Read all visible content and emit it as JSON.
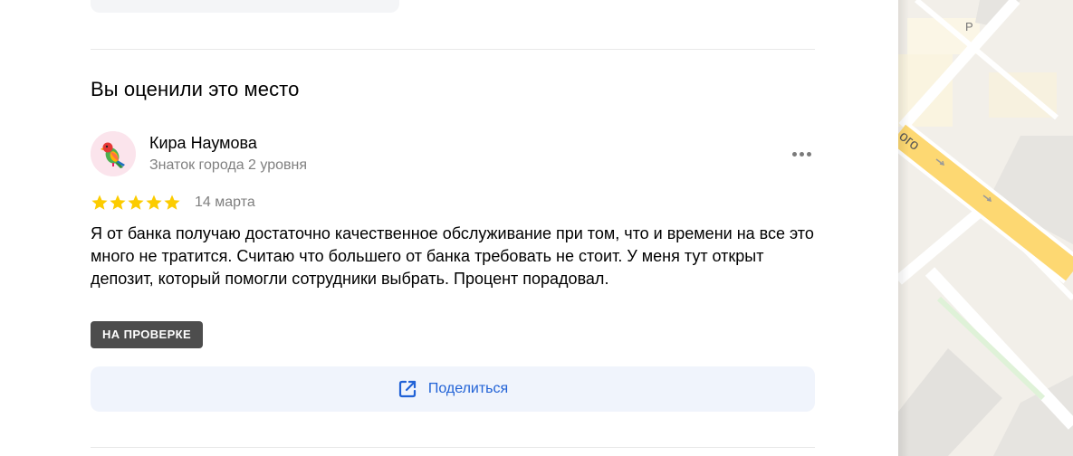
{
  "section": {
    "title": "Вы оценили это место"
  },
  "review": {
    "author_name": "Кира Наумова",
    "author_level": "Знаток города 2 уровня",
    "rating": 5,
    "rating_max": 5,
    "date": "14 марта",
    "text": "Я от банка получаю достаточно качественное обслуживание при том, что и времени на все это много не тратится. Считаю что большего от банка требовать не стоит. У меня тут открыт депозит, который помогли сотрудники выбрать. Процент порадовал.",
    "status_badge": "НА ПРОВЕРКЕ",
    "more_icon": "more-dots-icon",
    "avatar_icon": "parrot-icon"
  },
  "share": {
    "label": "Поделиться",
    "icon": "share-external-icon"
  },
  "map": {
    "street_label": "ого",
    "parking_label": "P"
  },
  "colors": {
    "star": "#fccc00",
    "accent_blue": "#2162d6",
    "badge_bg": "#4d4d4d",
    "share_bg": "#f0f4fc",
    "road_yellow": "#fdd872"
  }
}
